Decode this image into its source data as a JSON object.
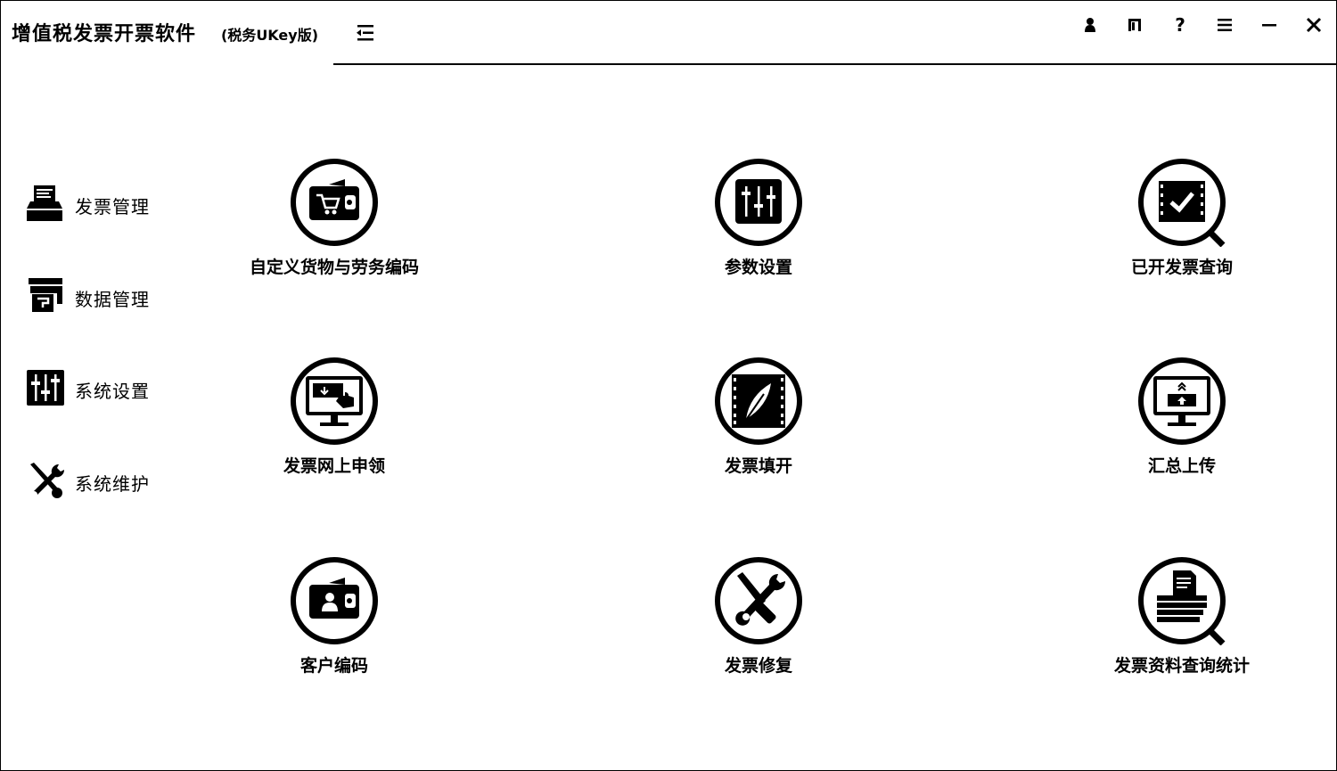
{
  "window": {
    "title": "增值税发票开票软件",
    "subtitle": "(税务UKey版)"
  },
  "toolbar": {
    "buttons": [
      {
        "name": "user-icon",
        "glyph": "♟"
      },
      {
        "name": "exit-login-icon",
        "glyph": ""
      },
      {
        "name": "help-icon",
        "glyph": "?"
      },
      {
        "name": "menu-icon",
        "glyph": "≡"
      },
      {
        "name": "minimize-icon",
        "glyph": "—"
      },
      {
        "name": "close-icon",
        "glyph": "✕"
      }
    ]
  },
  "sidebar": {
    "items": [
      {
        "label": "发票管理",
        "icon": "printer-icon"
      },
      {
        "label": "数据管理",
        "icon": "database-icon"
      },
      {
        "label": "系统设置",
        "icon": "sliders-icon"
      },
      {
        "label": "系统维护",
        "icon": "tools-icon"
      }
    ]
  },
  "tiles": [
    {
      "label": "自定义货物与劳务编码",
      "icon": "cart-wallet-icon"
    },
    {
      "label": "参数设置",
      "icon": "sliders-icon"
    },
    {
      "label": "已开发票查询",
      "icon": "check-search-icon"
    },
    {
      "label": "发票网上申领",
      "icon": "monitor-download-icon"
    },
    {
      "label": "发票填开",
      "icon": "feather-film-icon"
    },
    {
      "label": "汇总上传",
      "icon": "monitor-upload-icon"
    },
    {
      "label": "客户编码",
      "icon": "person-wallet-icon"
    },
    {
      "label": "发票修复",
      "icon": "tools-icon"
    },
    {
      "label": "发票资料查询统计",
      "icon": "documents-search-icon"
    }
  ]
}
